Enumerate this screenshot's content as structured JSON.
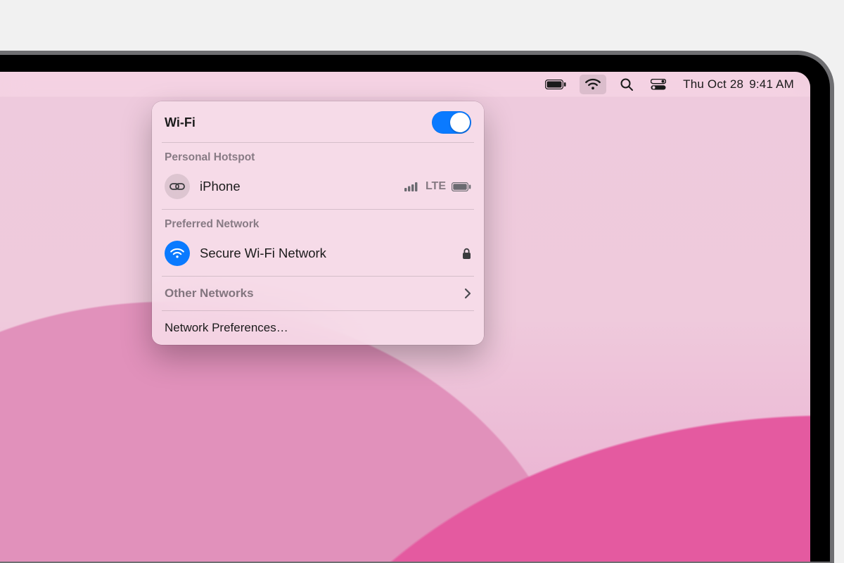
{
  "menubar": {
    "date": "Thu Oct 28",
    "time": "9:41 AM"
  },
  "panel": {
    "title": "Wi-Fi",
    "wifi_enabled": true,
    "sections": {
      "hotspot": {
        "header": "Personal Hotspot",
        "item": {
          "name": "iPhone",
          "signal_label": "LTE"
        }
      },
      "preferred": {
        "header": "Preferred Network",
        "item": {
          "name": "Secure Wi-Fi Network",
          "secured": true,
          "connected": true
        }
      }
    },
    "other_networks_label": "Other Networks",
    "preferences_label": "Network Preferences…"
  },
  "colors": {
    "accent": "#0a7aff"
  }
}
